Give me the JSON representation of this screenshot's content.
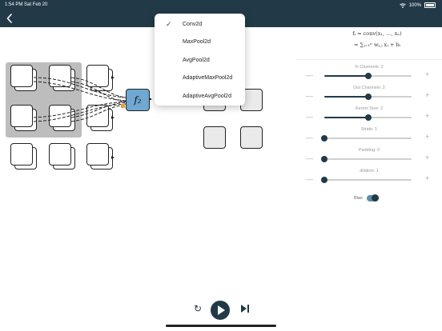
{
  "status_bar": {
    "time": "1:54 PM",
    "date": "Sat Feb 20",
    "battery": "100%",
    "wifi_icon": "wifi-icon",
    "battery_icon": "battery-icon"
  },
  "nav": {
    "back_icon": "chevron-left-icon"
  },
  "node_label": "f₂",
  "dropdown": {
    "selected": "Conv2d",
    "items": [
      "Conv2d",
      "MaxPool2d",
      "AvgPool2d",
      "AdaptiveMaxPool2d",
      "AdaptiveAvgPool2d"
    ]
  },
  "formula": {
    "line1": "fᵢ = conv(x₁, …, xₙ)",
    "line2": "= ∑ⱼ₌₁ⁿ wᵢ,ⱼ xⱼ + bᵢ"
  },
  "params": [
    {
      "label": "In Channels: 2",
      "level": 0.5
    },
    {
      "label": "Out Channels: 2",
      "level": 0.5
    },
    {
      "label": "Kernel Size: 2",
      "level": 0.5
    },
    {
      "label": "Stride: 1",
      "level": 0.0
    },
    {
      "label": "Padding: 0",
      "level": 0.0
    },
    {
      "label": "dilation: 1",
      "level": 0.0
    }
  ],
  "minus_symbol": "—",
  "plus_symbol": "+",
  "bias": {
    "label": "Bias",
    "enabled": true
  },
  "controls": {
    "reset_icon": "↻",
    "play_icon": "play-icon",
    "step_icon": "step-forward-icon"
  },
  "colors": {
    "header": "#223a48",
    "node_highlight": "#6ea8d3",
    "accent_orange": "#e3a03a"
  }
}
